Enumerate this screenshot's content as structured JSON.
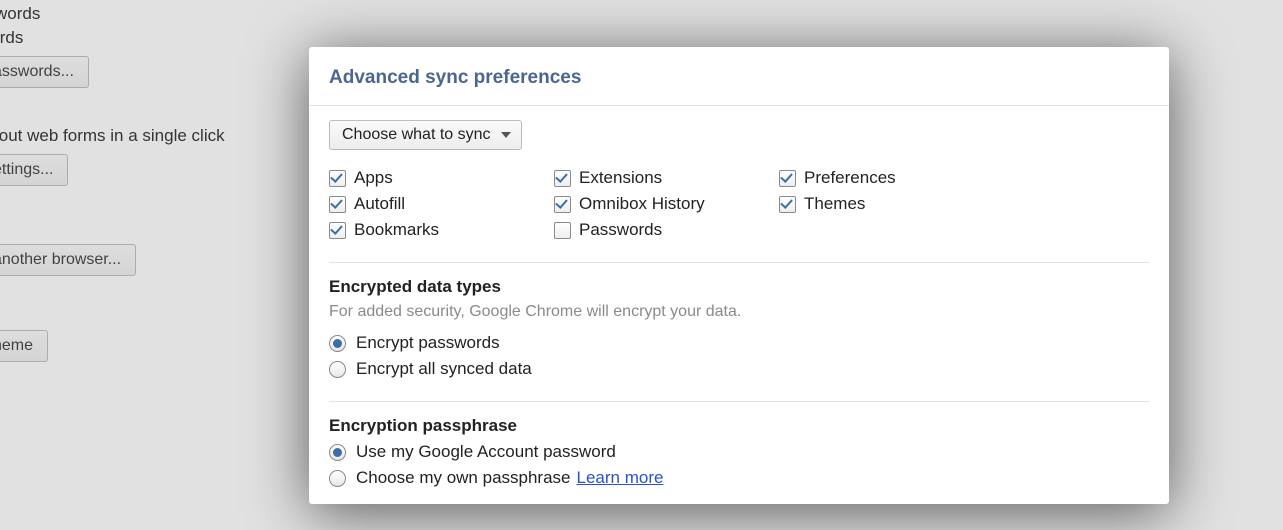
{
  "background": {
    "line1": "sswords",
    "line2": "words",
    "btn_passwords": "asswords...",
    "line3": "fill out web forms in a single click",
    "btn_settings": "ettings...",
    "btn_browser": "another browser...",
    "btn_theme": "heme"
  },
  "dialog": {
    "title": "Advanced sync preferences",
    "select_label": "Choose what to sync",
    "sync_items": [
      {
        "label": "Apps",
        "checked": true
      },
      {
        "label": "Extensions",
        "checked": true
      },
      {
        "label": "Preferences",
        "checked": true
      },
      {
        "label": "Autofill",
        "checked": true
      },
      {
        "label": "Omnibox History",
        "checked": true
      },
      {
        "label": "Themes",
        "checked": true
      },
      {
        "label": "Bookmarks",
        "checked": true
      },
      {
        "label": "Passwords",
        "checked": false
      }
    ],
    "encrypted": {
      "title": "Encrypted data types",
      "subtitle": "For added security, Google Chrome will encrypt your data.",
      "options": [
        {
          "label": "Encrypt passwords",
          "selected": true
        },
        {
          "label": "Encrypt all synced data",
          "selected": false
        }
      ]
    },
    "passphrase": {
      "title": "Encryption passphrase",
      "options": [
        {
          "label": "Use my Google Account password",
          "selected": true
        },
        {
          "label": "Choose my own passphrase",
          "selected": false
        }
      ],
      "learn_more": "Learn more"
    }
  }
}
